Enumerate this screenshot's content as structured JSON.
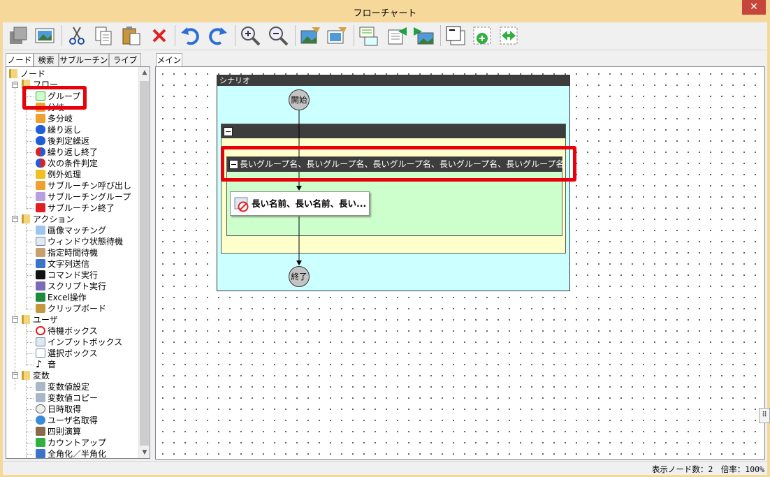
{
  "window": {
    "title": "フローチャート",
    "close_glyph": "✕"
  },
  "toolbar": {
    "buttons": [
      "properties-icon",
      "image-icon",
      "cut-icon",
      "copy-icon",
      "paste-icon",
      "delete-icon",
      "undo-icon",
      "redo-icon",
      "zoom-in-icon",
      "zoom-out-icon",
      "capture-icon",
      "capture-area-icon",
      "comment-icon",
      "move-left-icon",
      "move-right-icon",
      "group-icon",
      "add-node-icon",
      "swap-icon"
    ]
  },
  "left_tabs": [
    "ノード",
    "検索",
    "サブルーチン",
    "ライブラリ"
  ],
  "right_tabs": [
    "メイン"
  ],
  "tree": {
    "root": "ノード",
    "categories": {
      "flow": "フロー",
      "action": "アクション",
      "user": "ユーザ",
      "variable": "変数"
    },
    "flow_items": [
      "グループ",
      "分岐",
      "多分岐",
      "繰り返し",
      "後判定繰返",
      "繰り返し終了",
      "次の条件判定",
      "例外処理",
      "サブルーチン呼び出し",
      "サブルーチングループ",
      "サブルーチン終了"
    ],
    "action_items": [
      "画像マッチング",
      "ウィンドウ状態待機",
      "指定時間待機",
      "文字列送信",
      "コマンド実行",
      "スクリプト実行",
      "Excel操作",
      "クリップボード"
    ],
    "user_items": [
      "待機ボックス",
      "インプットボックス",
      "選択ボックス",
      "音"
    ],
    "variable_items": [
      "変数値設定",
      "変数値コピー",
      "日時取得",
      "ユーザ名取得",
      "四則演算",
      "カウントアップ",
      "全角化／半角化"
    ]
  },
  "flowchart": {
    "scenario_title": "シナリオ",
    "start_label": "開始",
    "end_label": "終了",
    "inner_group_title": "長いグループ名、長いグループ名、長いグループ名、長いグループ名、長いグループ名",
    "action_label": "長い名前、長い名前、長い..."
  },
  "status": {
    "text": "表示ノード数：2　倍率：100%"
  },
  "colors": {
    "highlight": "#e8000b",
    "scenario_bg": "#ccffff",
    "group_outer_bg": "#ffffcc",
    "group_inner_bg": "#ccffcc",
    "node_gray": "#c4c4c4"
  }
}
